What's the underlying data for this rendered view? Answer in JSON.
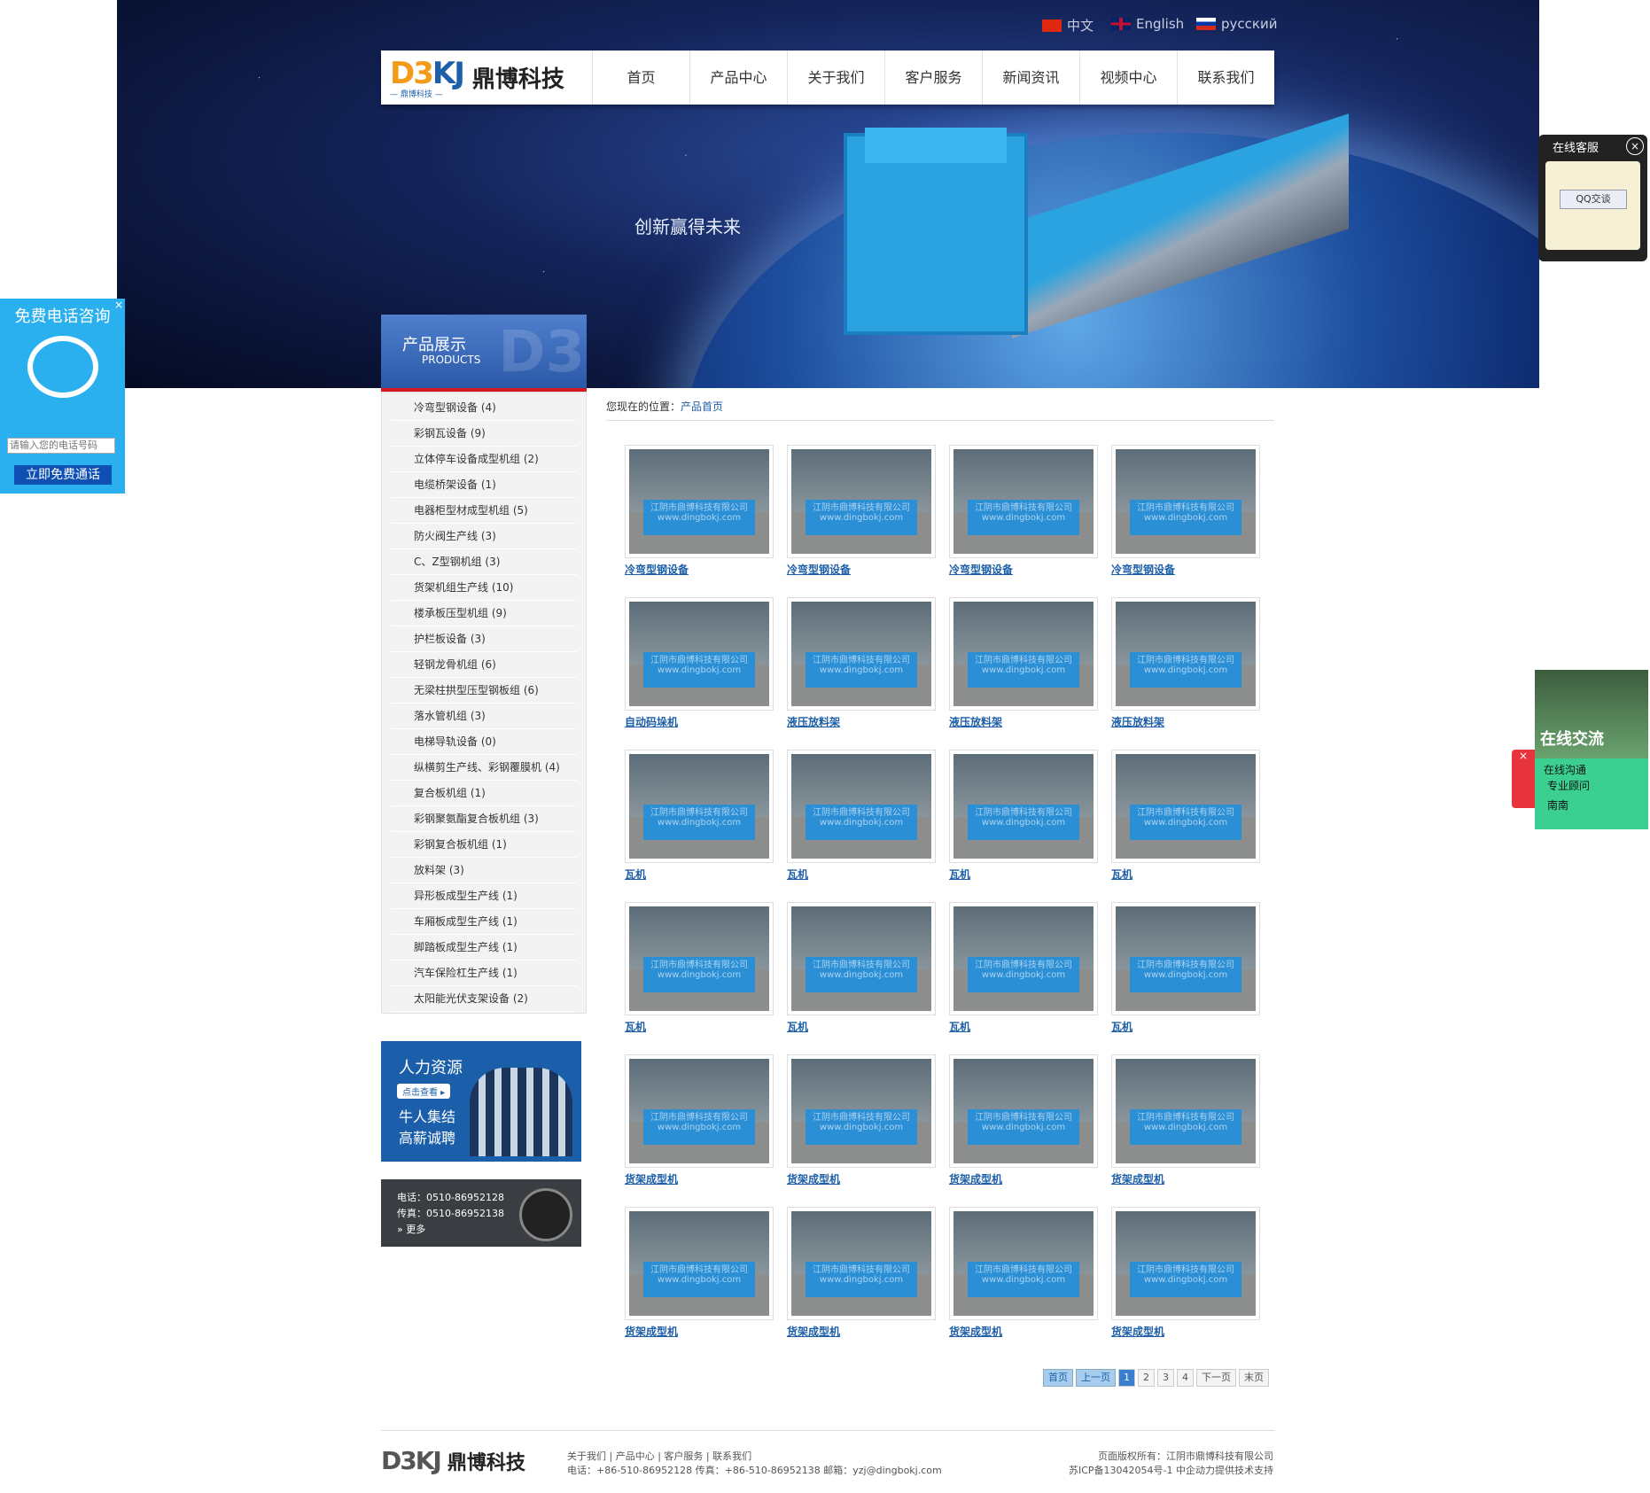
{
  "languages": [
    {
      "label": "中文",
      "flag": "china-flag-icon"
    },
    {
      "label": "English",
      "flag": "uk-flag-icon"
    },
    {
      "label": "русский",
      "flag": "russia-flag-icon"
    }
  ],
  "logo": {
    "mark_a": "D3",
    "mark_b": "KJ",
    "sub": "— 鼎博科技 —",
    "cn": "鼎博科技"
  },
  "nav": [
    "首页",
    "产品中心",
    "关于我们",
    "客户服务",
    "新闻资讯",
    "视频中心",
    "联系我们"
  ],
  "banner": {
    "slogan": "创新赢得未来"
  },
  "products_header": {
    "title": "产品展示",
    "subtitle": "PRODUCTS",
    "bg": "D3"
  },
  "categories": [
    "冷弯型钢设备 (4)",
    "彩钢瓦设备 (9)",
    "立体停车设备成型机组 (2)",
    "电缆桥架设备 (1)",
    "电器柜型材成型机组 (5)",
    "防火阀生产线 (3)",
    "C、Z型钢机组 (3)",
    "货架机组生产线 (10)",
    "楼承板压型机组 (9)",
    "护栏板设备 (3)",
    "轻钢龙骨机组 (6)",
    "无梁柱拱型压型钢板组 (6)",
    "落水管机组 (3)",
    "电梯导轨设备 (0)",
    "纵横剪生产线、彩钢覆膜机 (4)",
    "复合板机组 (1)",
    "彩钢聚氨酯复合板机组 (3)",
    "彩钢复合板机组 (1)",
    "放料架 (3)",
    "异形板成型生产线 (1)",
    "车厢板成型生产线 (1)",
    "脚踏板成型生产线 (1)",
    "汽车保险杠生产线 (1)",
    "太阳能光伏支架设备 (2)"
  ],
  "hr": {
    "title": "人力资源",
    "button": "点击查看 ▸",
    "line1": "牛人集结",
    "line2": "高薪诚聘"
  },
  "contact": {
    "tel": "电话：0510-86952128",
    "fax": "传真：0510-86952138",
    "more": "» 更多"
  },
  "breadcrumb": {
    "prefix": "您现在的位置：",
    "link": "产品首页"
  },
  "watermark": "江阴市鼎博科技有限公司\nwww.dingbokj.com",
  "products": [
    "冷弯型钢设备",
    "冷弯型钢设备",
    "冷弯型钢设备",
    "冷弯型钢设备",
    "自动码垛机",
    "液压放料架",
    "液压放料架",
    "液压放料架",
    "瓦机",
    "瓦机",
    "瓦机",
    "瓦机",
    "瓦机",
    "瓦机",
    "瓦机",
    "瓦机",
    "货架成型机",
    "货架成型机",
    "货架成型机",
    "货架成型机",
    "货架成型机",
    "货架成型机",
    "货架成型机",
    "货架成型机"
  ],
  "pager": {
    "first": "首页",
    "prev": "上一页",
    "pages": [
      "1",
      "2",
      "3",
      "4"
    ],
    "current": "1",
    "next": "下一页",
    "last": "末页"
  },
  "footer": {
    "mark": "D3KJ",
    "cn": "鼎博科技",
    "links": "关于我们 | 产品中心 | 客户服务 | 联系我们",
    "contact": "电话：+86-510-86952128 传真：+86-510-86952138 邮箱：yzj@dingbokj.com",
    "copyright": "页面版权所有：江阴市鼎博科技有限公司",
    "icp": "苏ICP备13042054号-1 中企动力提供技术支持"
  },
  "callbox": {
    "title": "免费电话咨询",
    "placeholder": "请输入您的电话号码",
    "button": "立即免费通话",
    "close": "×"
  },
  "kefu": {
    "title": "在线客服",
    "qq": "QQ交谈",
    "close": "×"
  },
  "chat": {
    "title": "在线交流",
    "line1": "在线沟通",
    "line2": "专业顾问",
    "line3": "南南"
  },
  "colors": {
    "nav_text": "#333333",
    "link_blue": "#1d5fa8",
    "accent_red": "#d31820",
    "call_blue": "#2bb0ef",
    "chat_green": "#3bd091"
  }
}
